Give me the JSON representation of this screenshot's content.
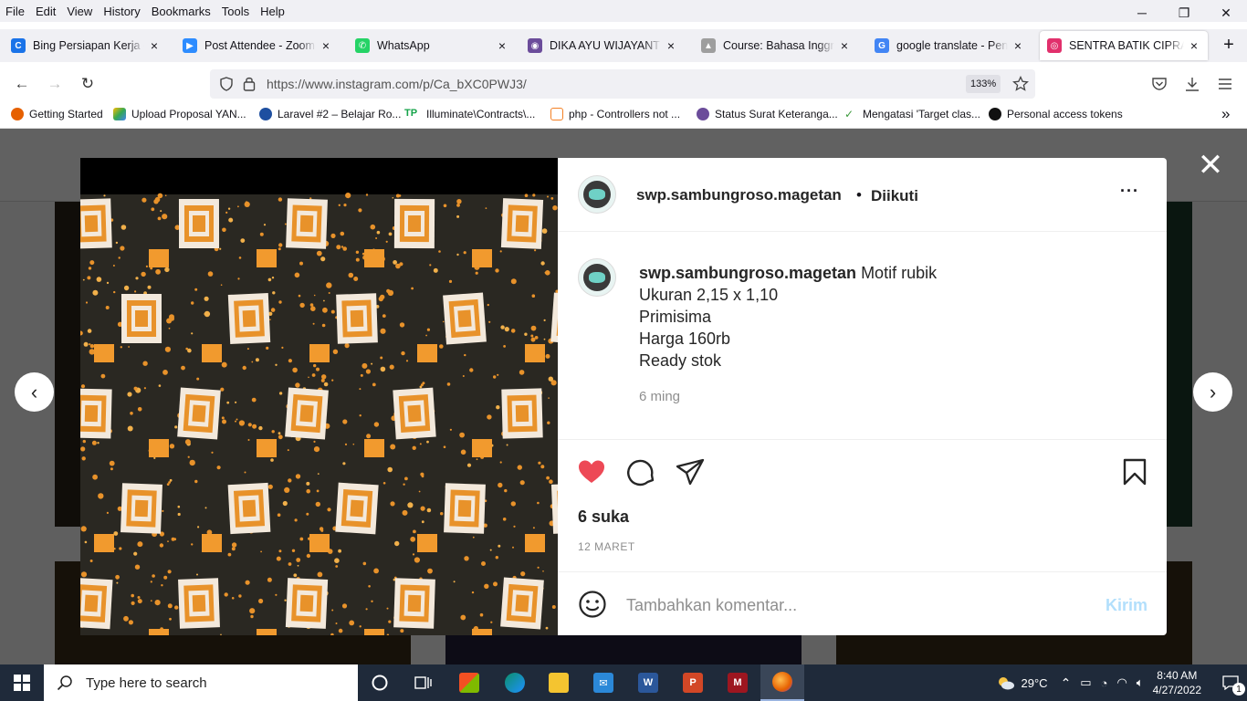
{
  "menubar": {
    "items": [
      "File",
      "Edit",
      "View",
      "History",
      "Bookmarks",
      "Tools",
      "Help"
    ]
  },
  "window_controls": {
    "minimize": "─",
    "restore": "❐",
    "close": "✕"
  },
  "tabs": [
    {
      "title": "Bing Persiapan Kerja - Pr",
      "color": "#1a73e8",
      "glyph": "C"
    },
    {
      "title": "Post Attendee - Zoom",
      "color": "#2d8cff",
      "glyph": "▶"
    },
    {
      "title": "WhatsApp",
      "color": "#25d366",
      "glyph": "✆"
    },
    {
      "title": "DIKA AYU WIJAYANTI | Sp",
      "color": "#6b4c9a",
      "glyph": "◉"
    },
    {
      "title": "Course: Bahasa Inggris Pe",
      "color": "#9e9e9e",
      "glyph": "▲"
    },
    {
      "title": "google translate - Penelu",
      "color": "#4285f4",
      "glyph": "G"
    },
    {
      "title": "SENTRA BATIK CIPRAT",
      "color": "#e1306c",
      "glyph": "◎"
    }
  ],
  "newtab_label": "+",
  "nav": {
    "back": "←",
    "forward": "→",
    "reload": "↻",
    "url": "https://www.instagram.com/p/Ca_bXC0PWJ3/",
    "zoom": "133%"
  },
  "bookmarks": [
    {
      "label": "Getting Started",
      "color": "#e66000"
    },
    {
      "label": "Upload Proposal YAN...",
      "color": "#fbbc04"
    },
    {
      "label": "Laravel #2 – Belajar Ro...",
      "color": "#1e4fa0"
    },
    {
      "label": "Illuminate\\Contracts\\...",
      "color": "#16a34a"
    },
    {
      "label": "php - Controllers not ...",
      "color": "#f48024"
    },
    {
      "label": "Status Surat Keteranga...",
      "color": "#6b4c9a"
    },
    {
      "label": "Mengatasi 'Target clas...",
      "color": "#3c9a3c"
    },
    {
      "label": "Personal access tokens",
      "color": "#111111"
    }
  ],
  "post": {
    "username": "swp.sambungroso.magetan",
    "dot": "•",
    "follow_status": "Diikuti",
    "more": "···",
    "caption_lines": [
      "Motif rubik",
      "Ukuran 2,15 x 1,10",
      "Primisima",
      "Harga 160rb",
      "Ready stok"
    ],
    "caption_time": "6 ming",
    "likes": "6 suka",
    "date": "12 MARET",
    "comment_placeholder": "Tambahkan komentar...",
    "send_label": "Kirim",
    "like_color": "#ed4956"
  },
  "modal": {
    "close": "✕",
    "prev": "‹",
    "next": "›"
  },
  "taskbar": {
    "search_placeholder": "Type here to search",
    "weather": "29°C",
    "time": "8:40 AM",
    "date": "4/27/2022",
    "notification_count": "1"
  }
}
